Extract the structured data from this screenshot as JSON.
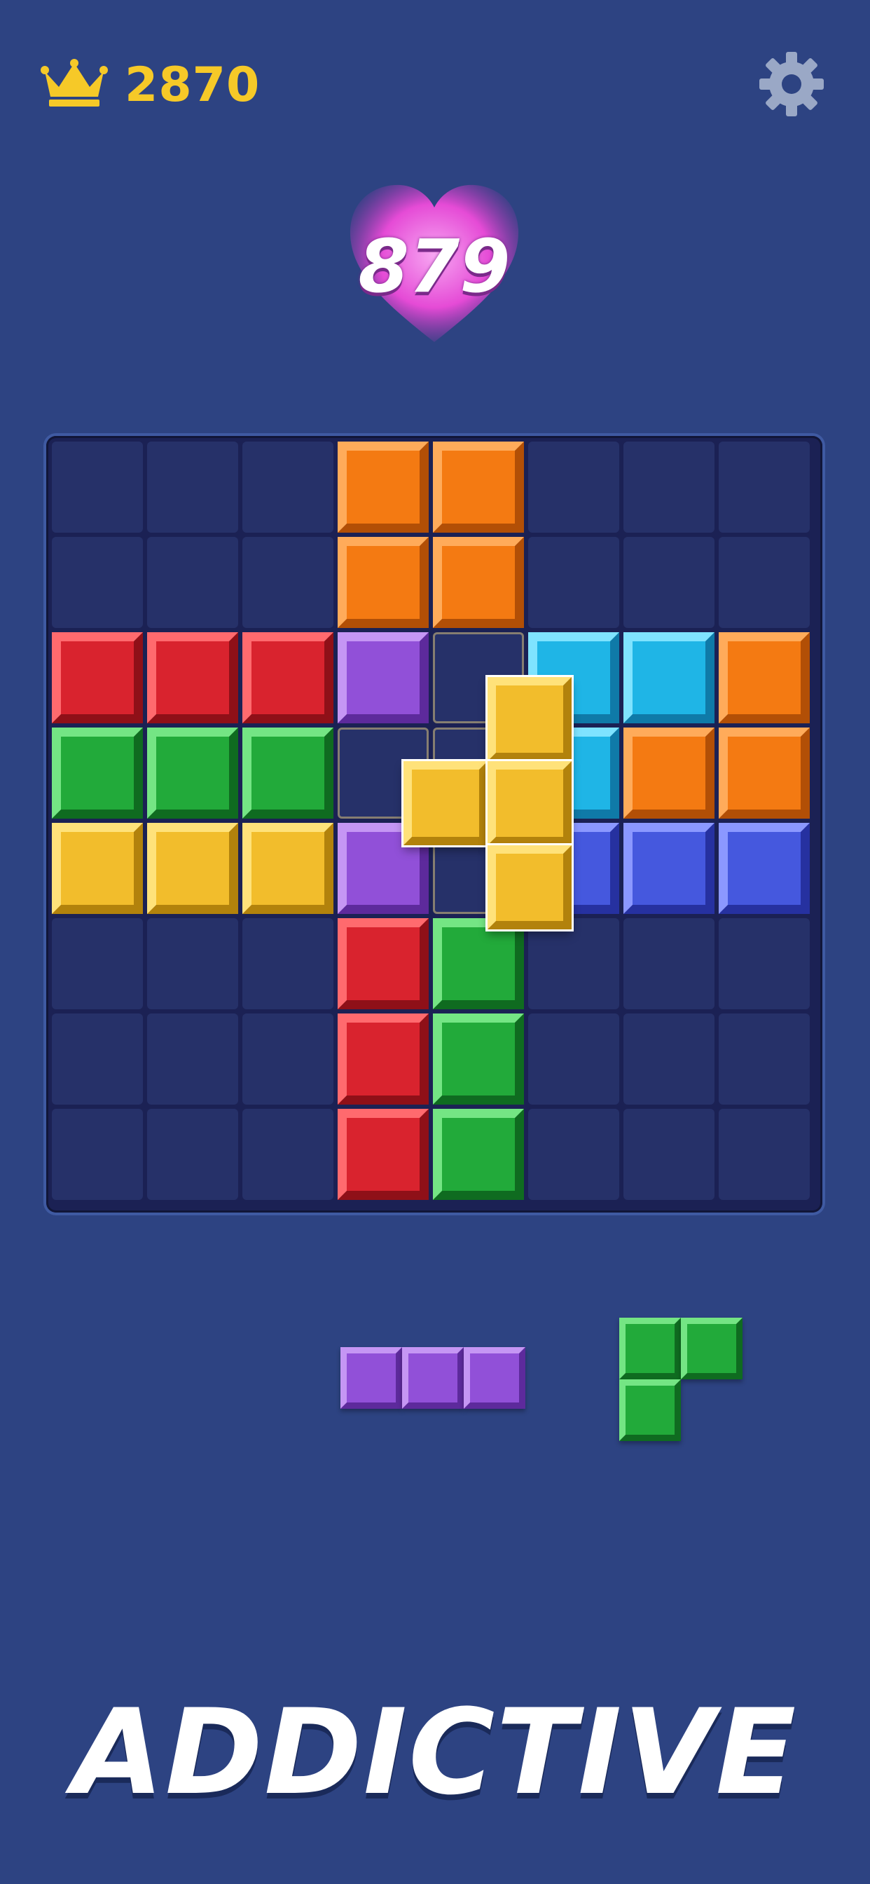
{
  "header": {
    "best_score": "2870",
    "crown_icon": "crown-icon",
    "settings_icon": "gear-icon",
    "best_score_color": "#f6c928"
  },
  "score": {
    "value": "879",
    "badge_icon": "heart-icon",
    "badge_color": "#e54bd6"
  },
  "board": {
    "rows": 8,
    "cols": 8,
    "cells": [
      [
        ".",
        ".",
        ".",
        "O",
        "O",
        ".",
        ".",
        "."
      ],
      [
        ".",
        ".",
        ".",
        "O",
        "O",
        ".",
        ".",
        "."
      ],
      [
        "R",
        "R",
        "R",
        "P",
        "h",
        "C",
        "C",
        "O"
      ],
      [
        "G",
        "G",
        "G",
        "h",
        "h",
        "C",
        "O",
        "O"
      ],
      [
        "Y",
        "Y",
        "Y",
        "P",
        "h",
        "B",
        "B",
        "B"
      ],
      [
        ".",
        ".",
        ".",
        "R",
        "G",
        ".",
        ".",
        "."
      ],
      [
        ".",
        ".",
        ".",
        "R",
        "G",
        ".",
        ".",
        "."
      ],
      [
        ".",
        ".",
        ".",
        "R",
        "G",
        ".",
        ".",
        "."
      ]
    ],
    "legend": {
      ".": "empty",
      "h": "placement-hint",
      "O": "orange",
      "R": "red",
      "P": "purple",
      "C": "cyan",
      "G": "green",
      "Y": "yellow",
      "B": "blue"
    }
  },
  "dragged_piece": {
    "color": "yellow",
    "shape": "T",
    "cells": [
      [
        0,
        1
      ],
      [
        1,
        0
      ],
      [
        1,
        1
      ],
      [
        2,
        1
      ]
    ]
  },
  "tray": [
    {
      "color": "purple",
      "shape": "I3-horizontal",
      "cells": [
        [
          0,
          0
        ],
        [
          0,
          1
        ],
        [
          0,
          2
        ]
      ]
    },
    {
      "color": "green",
      "shape": "L3",
      "cells": [
        [
          0,
          0
        ],
        [
          0,
          1
        ],
        [
          1,
          0
        ]
      ]
    }
  ],
  "palette": {
    "orange": {
      "face": "#f47a12",
      "light": "#ffab5a",
      "dark": "#b24f06"
    },
    "red": {
      "face": "#d9232e",
      "light": "#ff6a6e",
      "dark": "#8f1018"
    },
    "purple": {
      "face": "#9150d8",
      "light": "#c596f4",
      "dark": "#5d2a9c"
    },
    "cyan": {
      "face": "#1fb5e6",
      "light": "#7fe3ff",
      "dark": "#0f7aa8"
    },
    "green": {
      "face": "#22aa3a",
      "light": "#74e584",
      "dark": "#0f6b20"
    },
    "yellow": {
      "face": "#f2bd2c",
      "light": "#ffe27a",
      "dark": "#b2820c"
    },
    "blue": {
      "face": "#4558de",
      "light": "#8b98ff",
      "dark": "#2631a0"
    }
  },
  "slogan": "ADDICTIVE"
}
